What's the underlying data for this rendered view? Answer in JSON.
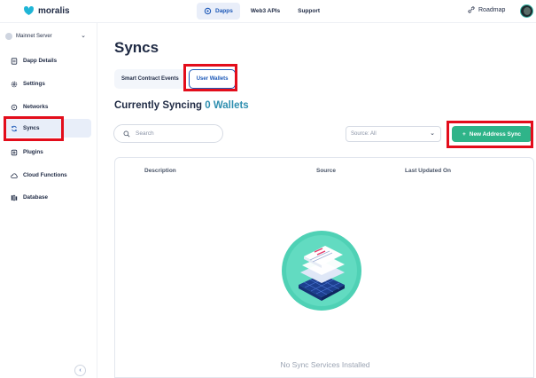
{
  "app": {
    "name": "moralis"
  },
  "topnav": {
    "tabs": [
      {
        "label": "Dapps",
        "active": true
      },
      {
        "label": "Web3 APIs",
        "active": false
      },
      {
        "label": "Support",
        "active": false
      }
    ],
    "roadmap": "Roadmap"
  },
  "sidebar": {
    "server": "Mainnet Server",
    "items": [
      {
        "label": "Dapp Details",
        "icon": "document-icon"
      },
      {
        "label": "Settings",
        "icon": "gear-icon"
      },
      {
        "label": "Networks",
        "icon": "network-icon"
      },
      {
        "label": "Syncs",
        "icon": "sync-icon",
        "active": true
      },
      {
        "label": "Plugins",
        "icon": "plugin-icon"
      },
      {
        "label": "Cloud Functions",
        "icon": "cloud-icon"
      },
      {
        "label": "Database",
        "icon": "database-icon"
      }
    ],
    "collapse": "‹"
  },
  "main": {
    "title": "Syncs",
    "tabs": [
      {
        "label": "Smart Contract Events",
        "active": false
      },
      {
        "label": "User Wallets",
        "active": true
      }
    ],
    "syncing": {
      "prefix": "Currently Syncing",
      "count": "0 Wallets"
    },
    "search": {
      "placeholder": "Search"
    },
    "source_filter": "Source: All",
    "new_sync_button": "New Address Sync",
    "table": {
      "headers": [
        "Description",
        "Source",
        "Last Updated On"
      ],
      "empty": "No Sync Services Installed"
    }
  },
  "colors": {
    "accent": "#1d59b8",
    "primary_button": "#2fb489",
    "highlight": "#e30d1b"
  }
}
